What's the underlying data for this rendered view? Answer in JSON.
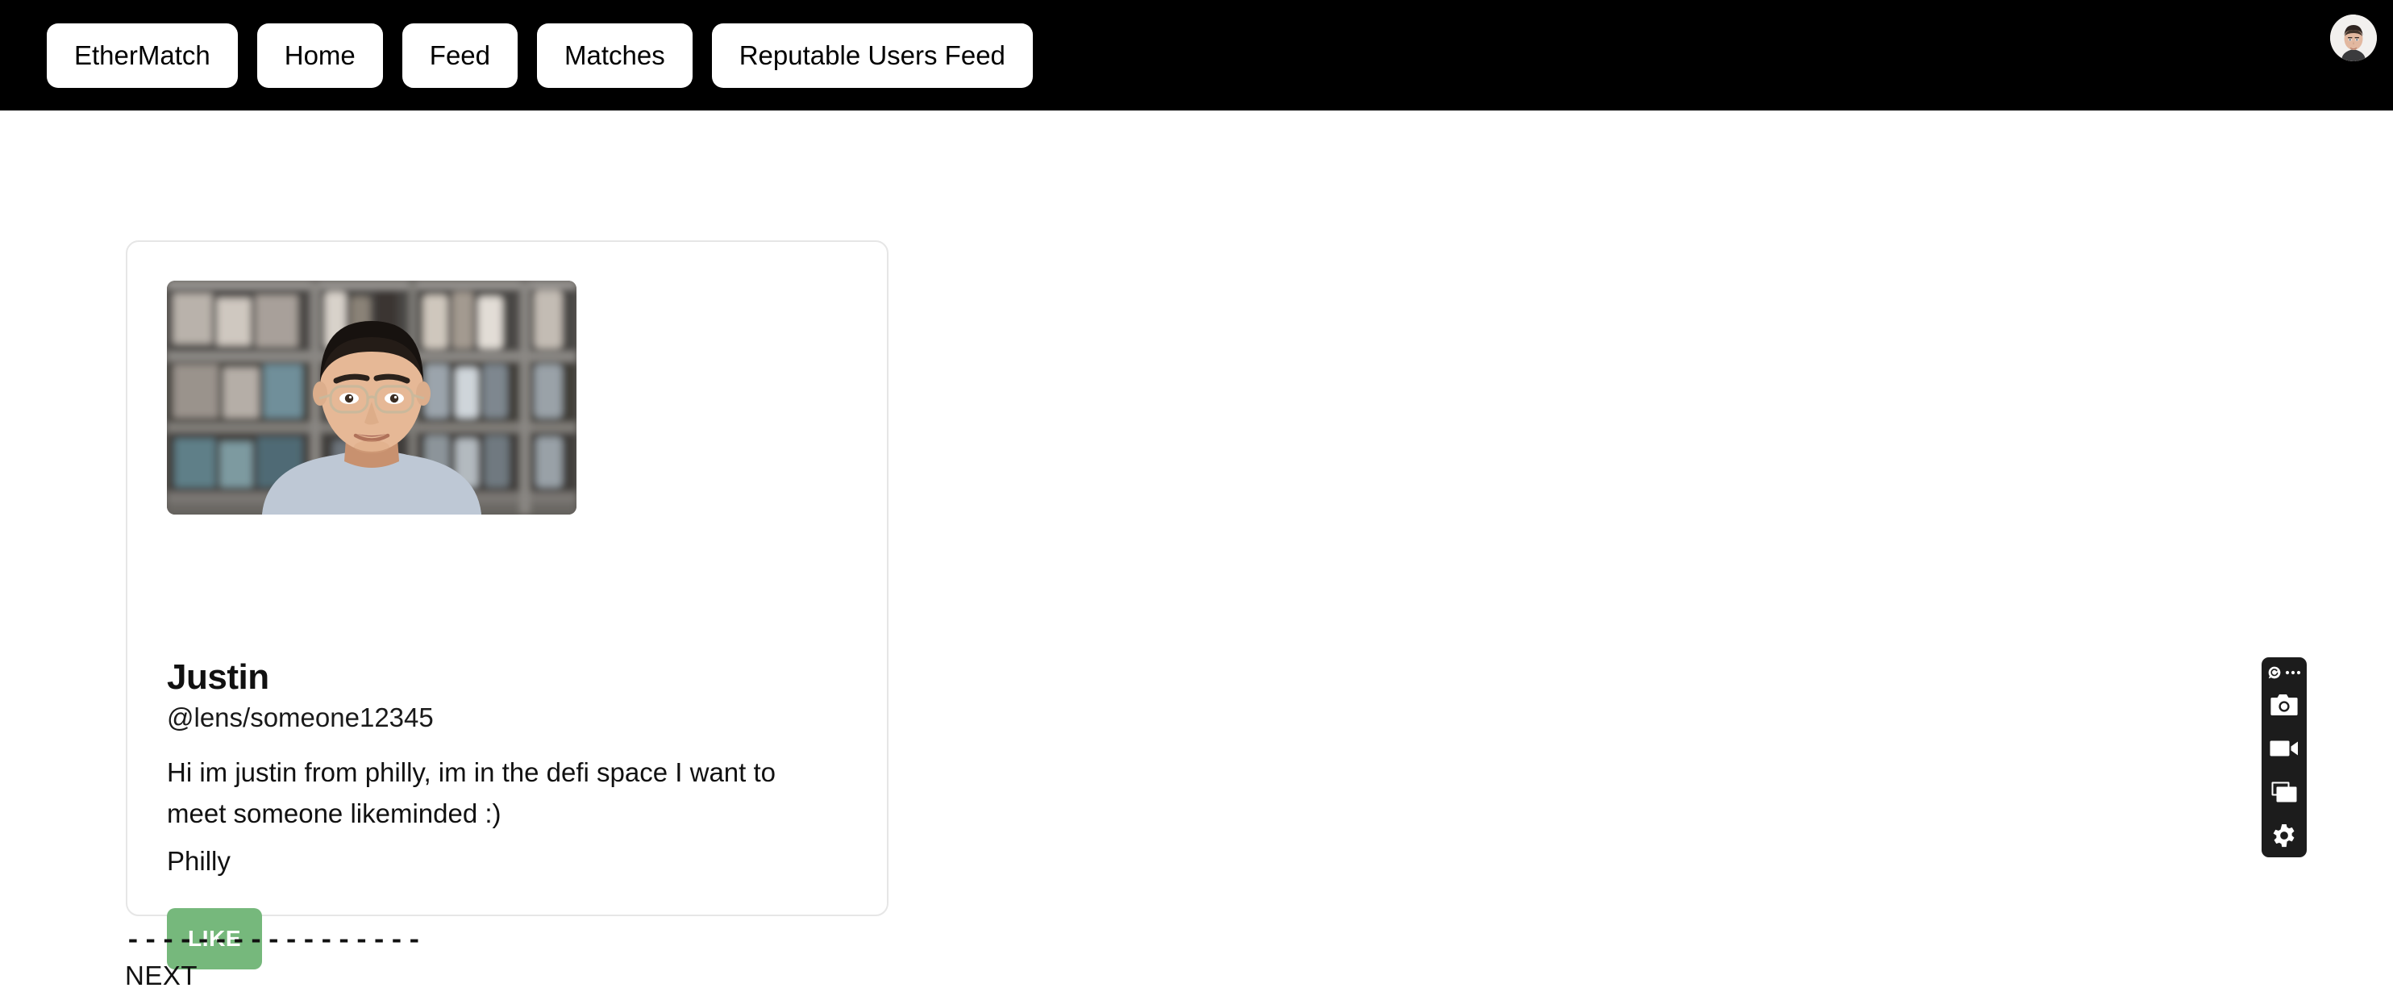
{
  "nav": {
    "items": [
      {
        "label": "EtherMatch",
        "name": "nav-button-ethermatch"
      },
      {
        "label": "Home",
        "name": "nav-button-home"
      },
      {
        "label": "Feed",
        "name": "nav-button-feed"
      },
      {
        "label": "Matches",
        "name": "nav-button-matches"
      },
      {
        "label": "Reputable Users Feed",
        "name": "nav-button-reputable-users-feed"
      }
    ],
    "avatar_icon": "user-avatar-icon",
    "background_color": "#000000",
    "button_color": "#ffffff"
  },
  "card": {
    "photo_icon": "profile-photo-image",
    "name": "Justin",
    "handle": "@lens/someone12345",
    "bio": "Hi im justin from philly, im in the defi space I want to meet someone likeminded :)",
    "location": "Philly",
    "like_label": "LIKE",
    "like_color": "#76b87c",
    "border_color": "#e6e6e6"
  },
  "below_card": {
    "separator": "-----------------",
    "next_label": "NEXT"
  },
  "recorder": {
    "logo_icon": "recorder-logo-icon",
    "menu_icon": "more-options-icon",
    "items": [
      {
        "icon": "camera-icon",
        "name": "screenshot-button"
      },
      {
        "icon": "video-camera-icon",
        "name": "record-video-button"
      },
      {
        "icon": "window-capture-icon",
        "name": "capture-window-button"
      },
      {
        "icon": "gear-icon",
        "name": "settings-button"
      }
    ],
    "background_color": "#1c1c1c"
  }
}
